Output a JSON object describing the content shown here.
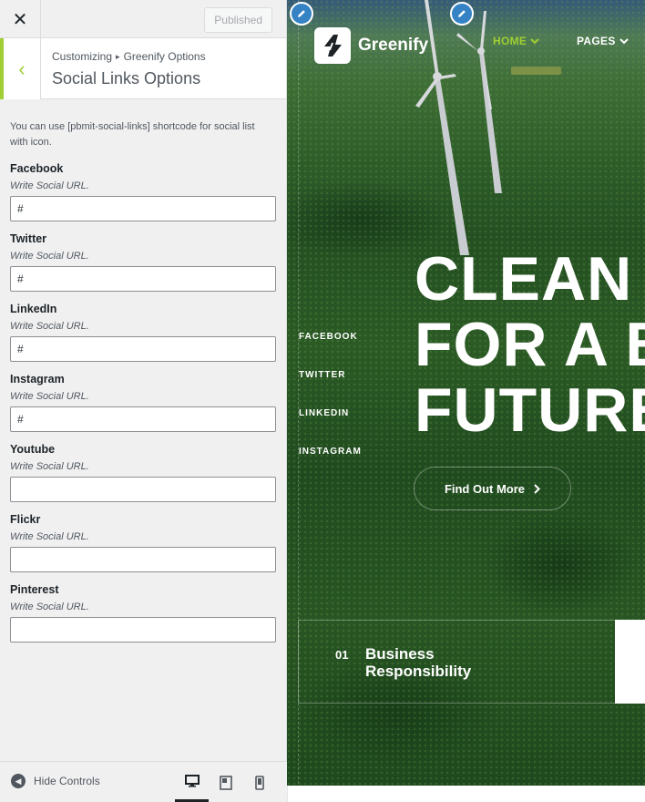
{
  "customizer": {
    "published_label": "Published",
    "breadcrumb": {
      "parent": "Customizing",
      "current": "Greenify Options"
    },
    "section_title": "Social Links Options",
    "description": "You can use [pbmit-social-links] shortcode for social list with icon.",
    "fields": [
      {
        "label": "Facebook",
        "hint": "Write Social URL.",
        "value": "#"
      },
      {
        "label": "Twitter",
        "hint": "Write Social URL.",
        "value": "#"
      },
      {
        "label": "LinkedIn",
        "hint": "Write Social URL.",
        "value": "#"
      },
      {
        "label": "Instagram",
        "hint": "Write Social URL.",
        "value": "#"
      },
      {
        "label": "Youtube",
        "hint": "Write Social URL.",
        "value": ""
      },
      {
        "label": "Flickr",
        "hint": "Write Social URL.",
        "value": ""
      },
      {
        "label": "Pinterest",
        "hint": "Write Social URL.",
        "value": ""
      }
    ],
    "hide_controls_label": "Hide Controls",
    "accent_color": "#9fcf33"
  },
  "preview": {
    "logo_text": "Greenify",
    "nav": {
      "home": "HOME",
      "pages": "PAGES"
    },
    "headline": {
      "line1": "CLEAN",
      "line2": "FOR A B",
      "line3": "FUTURE"
    },
    "social_links": [
      "FACEBOOK",
      "TWITTER",
      "LINKEDIN",
      "INSTAGRAM"
    ],
    "cta_label": "Find Out More",
    "feature": {
      "number": "01",
      "text": "Business Responsibility"
    }
  }
}
